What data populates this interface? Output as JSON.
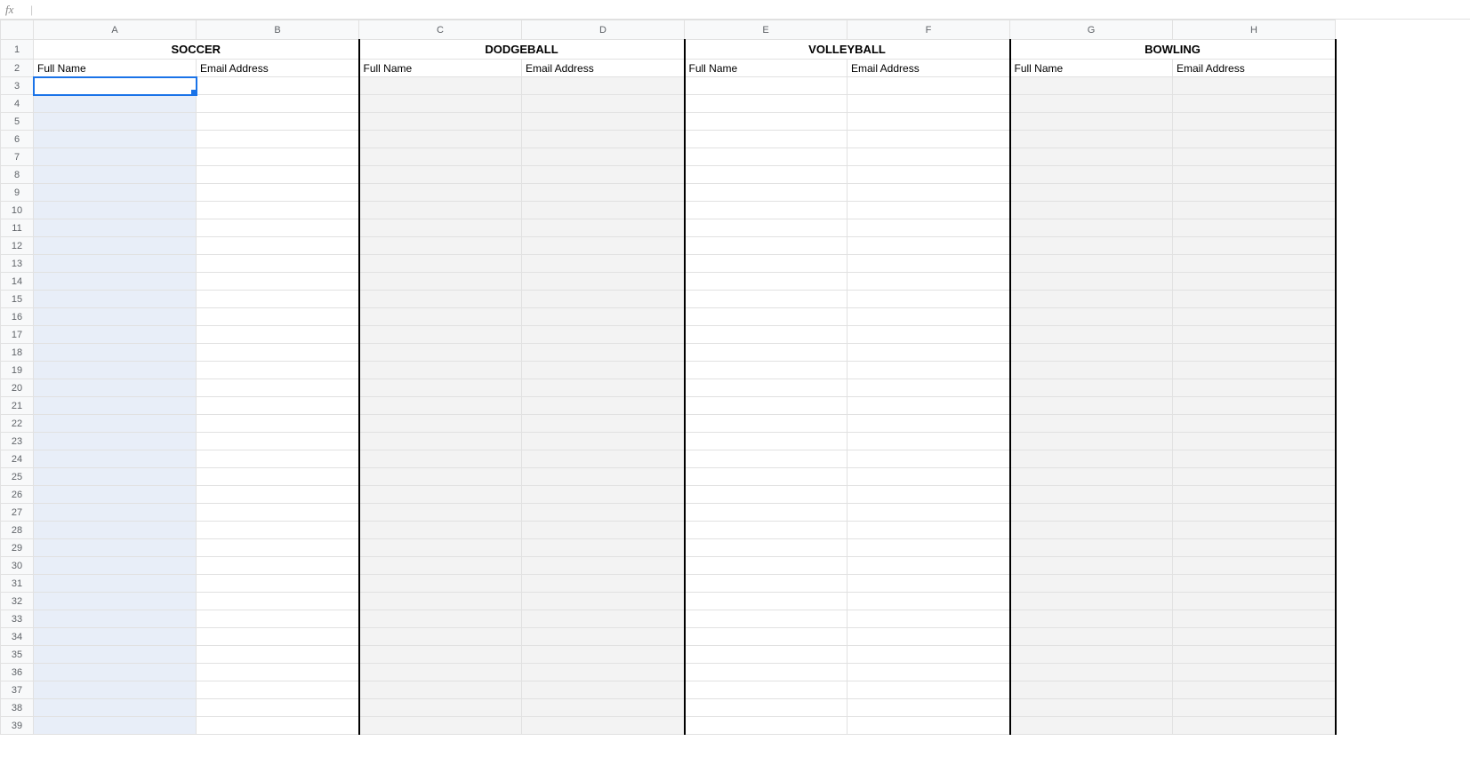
{
  "formula_bar": {
    "label": "fx",
    "value": ""
  },
  "columns": [
    "A",
    "B",
    "C",
    "D",
    "E",
    "F",
    "G",
    "H"
  ],
  "row_count": 39,
  "sections": [
    {
      "title": "SOCCER",
      "cols": [
        "A",
        "B"
      ],
      "labels": {
        "name": "Full Name",
        "email": "Email Address"
      }
    },
    {
      "title": "DODGEBALL",
      "cols": [
        "C",
        "D"
      ],
      "labels": {
        "name": "Full Name",
        "email": "Email Address"
      }
    },
    {
      "title": "VOLLEYBALL",
      "cols": [
        "E",
        "F"
      ],
      "labels": {
        "name": "Full Name",
        "email": "Email Address"
      }
    },
    {
      "title": "BOWLING",
      "cols": [
        "G",
        "H"
      ],
      "labels": {
        "name": "Full Name",
        "email": "Email Address"
      }
    }
  ],
  "active_cell": "A3",
  "selection_column": "A",
  "selection_from_row": 3
}
